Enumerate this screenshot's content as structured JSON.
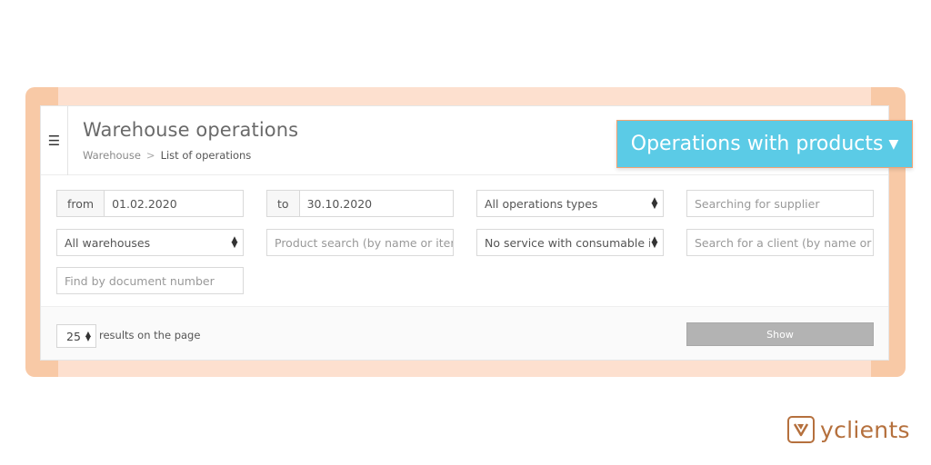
{
  "header": {
    "title": "Warehouse operations",
    "breadcrumb": {
      "parent": "Warehouse",
      "separator": ">",
      "current": "List of operations"
    }
  },
  "callout": {
    "label": "Operations with products"
  },
  "filters": {
    "from_label": "from",
    "from_value": "01.02.2020",
    "to_label": "to",
    "to_value": "30.10.2020",
    "operation_type": "All operations types",
    "supplier_placeholder": "Searching for supplier",
    "warehouse": "All warehouses",
    "product_placeholder": "Product search (by name or item n",
    "service": "No service with consumable items",
    "client_placeholder": "Search for a client (by name or ph",
    "document_placeholder": "Find by document number"
  },
  "footer": {
    "per_page_value": "25",
    "per_page_label": "results on the page",
    "show_label": "Show"
  },
  "brand": {
    "name": "yclients",
    "color": "#b5703d"
  },
  "colors": {
    "callout_bg": "#5bcbe6",
    "callout_border": "#f2a373",
    "frame": "#f8c9a6"
  }
}
